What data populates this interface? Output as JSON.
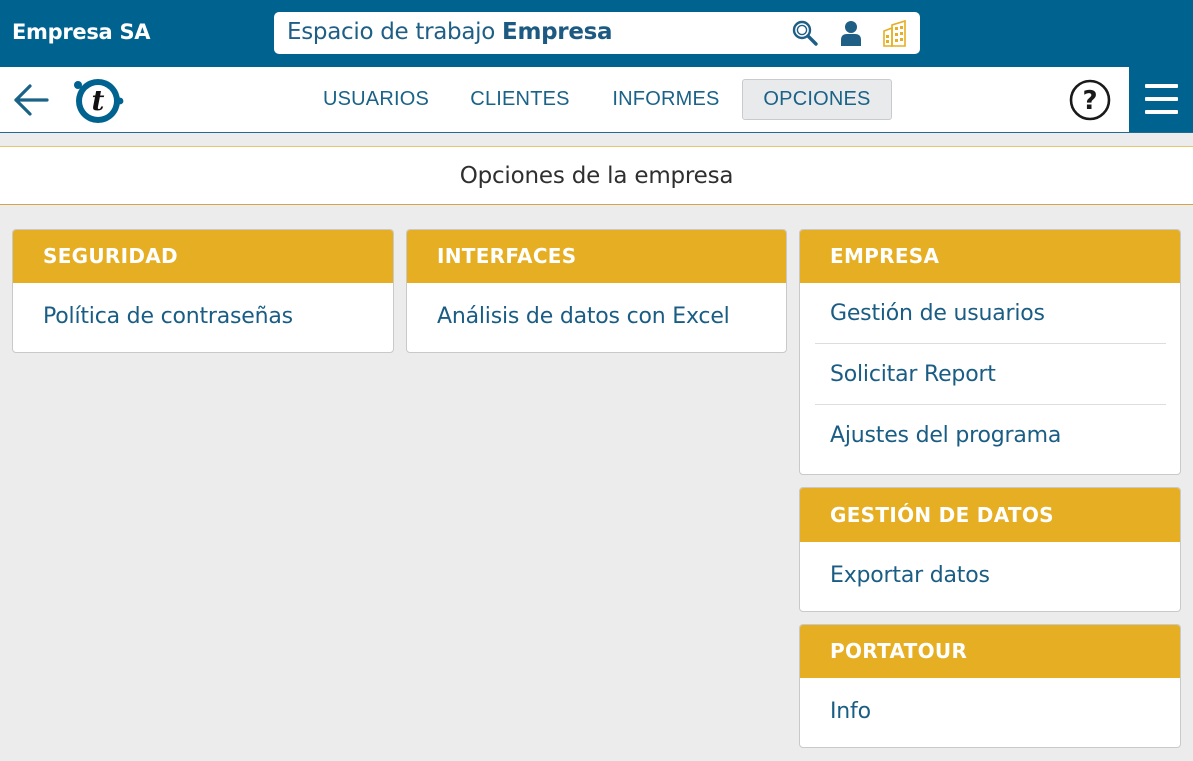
{
  "topbar": {
    "company": "Empresa SA",
    "workspace_prefix": "Espacio de trabajo",
    "workspace_name": "Empresa",
    "icons": [
      "search-icon",
      "user-icon",
      "building-icon"
    ]
  },
  "nav": {
    "tabs": [
      {
        "label": "USUARIOS"
      },
      {
        "label": "CLIENTES"
      },
      {
        "label": "INFORMES"
      },
      {
        "label": "OPCIONES",
        "active": true
      }
    ],
    "help_label": "?"
  },
  "page": {
    "title": "Opciones de la empresa"
  },
  "cards": {
    "seguridad": {
      "title": "SEGURIDAD",
      "items": [
        "Política de contraseñas"
      ]
    },
    "interfaces": {
      "title": "INTERFACES",
      "items": [
        "Análisis de datos con Excel"
      ]
    },
    "empresa": {
      "title": "EMPRESA",
      "items": [
        "Gestión de usuarios",
        "Solicitar Report",
        "Ajustes del programa"
      ]
    },
    "gestion_datos": {
      "title": "GESTIÓN DE DATOS",
      "items": [
        "Exportar datos"
      ]
    },
    "portatour": {
      "title": "PORTATOUR",
      "items": [
        "Info"
      ]
    }
  },
  "colors": {
    "brand_blue": "#00628f",
    "accent_gold": "#e6ae22",
    "link_blue": "#1a5d84"
  }
}
